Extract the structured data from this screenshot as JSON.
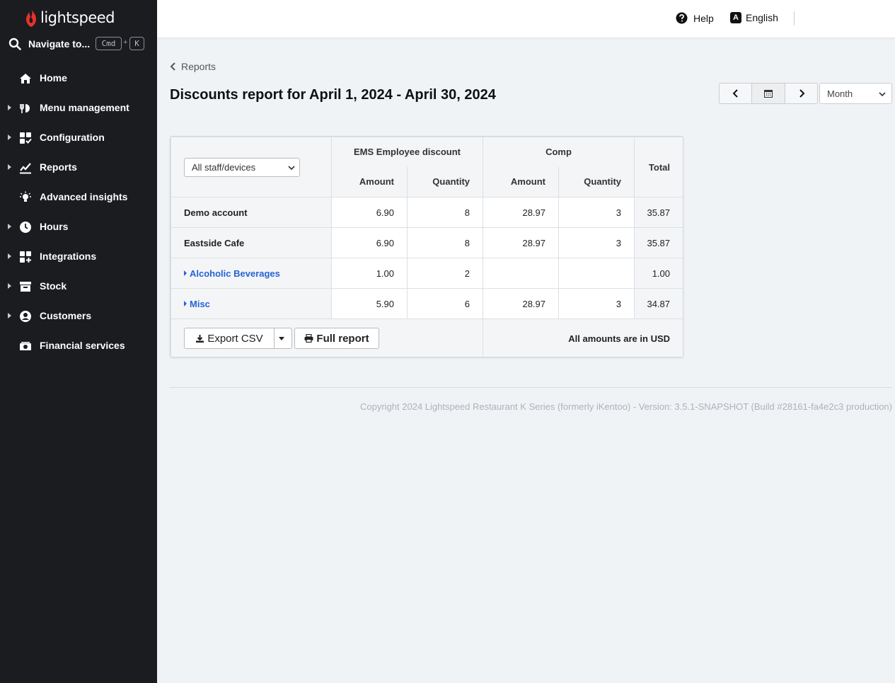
{
  "brand": {
    "name": "lightspeed",
    "accent": "#e8322b"
  },
  "sidebar": {
    "navigate": {
      "label": "Navigate to...",
      "kbd_cmd": "Cmd",
      "kbd_plus": "+",
      "kbd_key": "K"
    },
    "items": [
      {
        "label": "Home",
        "icon": "home-icon",
        "expandable": false
      },
      {
        "label": "Menu management",
        "icon": "menu-management-icon",
        "expandable": true
      },
      {
        "label": "Configuration",
        "icon": "configuration-icon",
        "expandable": true
      },
      {
        "label": "Reports",
        "icon": "reports-icon",
        "expandable": true
      },
      {
        "label": "Advanced insights",
        "icon": "lightbulb-icon",
        "expandable": false
      },
      {
        "label": "Hours",
        "icon": "clock-icon",
        "expandable": true
      },
      {
        "label": "Integrations",
        "icon": "integrations-icon",
        "expandable": true
      },
      {
        "label": "Stock",
        "icon": "stock-icon",
        "expandable": true
      },
      {
        "label": "Customers",
        "icon": "customers-icon",
        "expandable": true
      },
      {
        "label": "Financial services",
        "icon": "money-icon",
        "expandable": false
      }
    ]
  },
  "header": {
    "help_label": "Help",
    "language_label": "English",
    "language_glyph": "A"
  },
  "main": {
    "back_label": "Reports",
    "title": "Discounts report for April 1, 2024 - April 30, 2024",
    "period_select": "Month",
    "report": {
      "filter": "All staff/devices",
      "groups": [
        "EMS Employee discount",
        "Comp"
      ],
      "subcolumns": [
        "Amount",
        "Quantity"
      ],
      "total_label": "Total",
      "rows": [
        {
          "name": "Demo account",
          "ems_amount": "6.90",
          "ems_qty": "8",
          "comp_amount": "28.97",
          "comp_qty": "3",
          "total": "35.87",
          "link": false
        },
        {
          "name": "Eastside Cafe",
          "ems_amount": "6.90",
          "ems_qty": "8",
          "comp_amount": "28.97",
          "comp_qty": "3",
          "total": "35.87",
          "link": false
        },
        {
          "name": "Alcoholic Beverages",
          "ems_amount": "1.00",
          "ems_qty": "2",
          "comp_amount": "",
          "comp_qty": "",
          "total": "1.00",
          "link": true
        },
        {
          "name": "Misc",
          "ems_amount": "5.90",
          "ems_qty": "6",
          "comp_amount": "28.97",
          "comp_qty": "3",
          "total": "34.87",
          "link": true
        }
      ],
      "export_label": "Export CSV",
      "full_report_label": "Full report",
      "currency_note": "All amounts are in USD"
    }
  },
  "footer": {
    "copyright": "Copyright 2024 Lightspeed Restaurant K Series (formerly iKentoo) - Version: 3.5.1-SNAPSHOT (Build #28161-fa4e2c3 production)"
  }
}
